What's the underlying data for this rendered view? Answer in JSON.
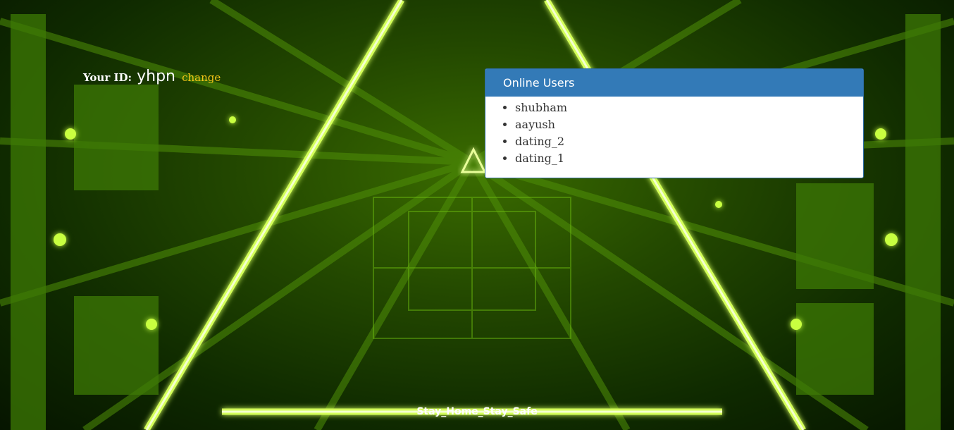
{
  "user": {
    "id_label": "Your ID:",
    "id_value": "yhpn",
    "change_label": "change"
  },
  "online_users": {
    "title": "Online Users",
    "items": [
      "shubham",
      "aayush",
      "dating_2",
      "dating_1"
    ]
  },
  "footer": {
    "text": "Stay_Home_Stay_Safe"
  },
  "colors": {
    "panel_header": "#337ab7",
    "change_link": "#f5c518",
    "neon": "#b6ff2e"
  }
}
